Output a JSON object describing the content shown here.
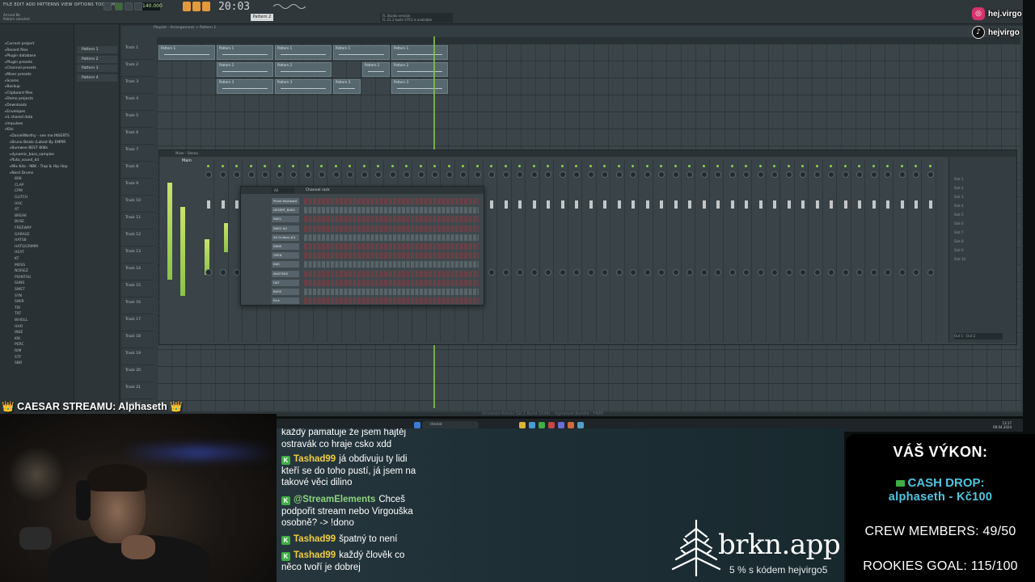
{
  "daw": {
    "menu": "FILE EDIT ADD PATTERNS VIEW OPTIONS TOOLS HELP",
    "song_info": [
      "Arrived 8b",
      "Pattern selected"
    ],
    "tempo": "140.000",
    "clock": "20:03",
    "clock_small": "0",
    "pattern_selector": "Pattern 2",
    "hint": [
      "FL Studio version",
      "FL 21.2 build 3753 is available"
    ],
    "browser_items": [
      "Current project",
      "Recent files",
      "Plugin database",
      "Plugin presets",
      "Channel presets",
      "Mixer presets",
      "Scores",
      "Backup",
      "Clipboard files",
      "Demo projects",
      "Downloads",
      "Envelopes",
      "IL shared data",
      "Impulses",
      "Kits"
    ],
    "kits_items": [
      "DanielWorthy - see me INSERTS",
      "Bruno Beats (Latest By EMPIR",
      "Bumwee BEST 808s",
      "dynamic_bass_samples",
      "fluto_sound_kit",
      "Mix Kits - 9BK - Trap & Hip Hop",
      "Nord Drums"
    ],
    "nord_items": [
      "808",
      "CLAP",
      "CPM",
      "GLITCH",
      "HHC",
      "AT",
      "BREAK",
      "BUSE",
      "FREEWAY",
      "GARAGE",
      "HATS8",
      "HATS/GRIMM",
      "HEAT",
      "KT",
      "MOSS",
      "NOISEZ",
      "POINTHU",
      "SUNS",
      "SWET",
      "SYN",
      "SWIR",
      "TIR",
      "TRT",
      "WHOLL",
      "HHO",
      "INSE",
      "KIK",
      "PERC",
      "RIM",
      "STF",
      "SNR"
    ],
    "patterns": [
      "Pattern 1",
      "Pattern 2",
      "Pattern 3",
      "Pattern 4"
    ],
    "playlist_title": "Playlist - Arrangement > Pattern 1",
    "tracks": [
      "Track 1",
      "Track 2",
      "Track 3",
      "Track 4",
      "Track 5",
      "Track 6",
      "Track 7",
      "Track 8",
      "Track 9",
      "Track 10",
      "Track 11",
      "Track 12",
      "Track 13",
      "Track 14",
      "Track 15",
      "Track 16",
      "Track 17",
      "Track 18",
      "Track 19",
      "Track 20",
      "Track 21",
      "Track 22"
    ],
    "clips": [
      {
        "label": "Pattern 1",
        "row": 0
      },
      {
        "label": "Pattern 2",
        "row": 1
      },
      {
        "label": "Pattern 3",
        "row": 2
      }
    ],
    "mixer_title": "Mixer - Stereo",
    "mixer_master": "Main",
    "mixer_slots": [
      "Slot 1",
      "Slot 2",
      "Slot 3",
      "Slot 4",
      "Slot 5",
      "Slot 6",
      "Slot 7",
      "Slot 8",
      "Slot 9",
      "Slot 10"
    ],
    "mixer_out": "Out 1 - Out 2",
    "rack_title": "Channel rack",
    "rack_filter": "All",
    "rack_channels": [
      "Plonk Keyboard",
      "DESERT_BASS",
      "SNR1",
      "SNR2 #2",
      "Air Guitars #4",
      "SNRE",
      "OPEN",
      "KNS",
      "MASTERS",
      "HAT",
      "BASS",
      "Kick"
    ],
    "version_text": "Vincenzo Kinisis (Gt 2 Build 1549) - Signature Bundle - FREE",
    "taskbar_search": "Hledat",
    "taskbar_clock": [
      "13:17",
      "09.04.2024"
    ]
  },
  "social": {
    "instagram": "hej.virgo",
    "tiktok": "hejvirgo"
  },
  "caesar": {
    "label": "CAESAR STREAMU: Alphaseth",
    "crown": "👑"
  },
  "chat": [
    {
      "user": "",
      "text": "každý pamatuje že jsem hajtěj ostravák co hraje csko xdd",
      "badge": false
    },
    {
      "user": "Tashad99",
      "text": "já obdivuju ty lidi kteří se do toho pustí, já jsem na takové věci dilino",
      "badge": true
    },
    {
      "user": "@StreamElements",
      "text": "Chceš podpořit stream nebo Virgouška osobně? -> !dono",
      "badge": true,
      "se": true
    },
    {
      "user": "Tashad99",
      "text": "špatný to není",
      "badge": true
    },
    {
      "user": "Tashad99",
      "text": "každý člověk co něco tvoří je dobrej",
      "badge": true
    }
  ],
  "sponsor": {
    "logo_text": "brkn.app",
    "subtitle": "5 % s kódem hejvirgo5"
  },
  "stats": {
    "title": "VÁŠ VÝKON:",
    "cash_drop_label": "CASH DROP:",
    "cash_drop_user": "alphaseth - Kč100",
    "crew": "CREW MEMBERS: 49/50",
    "rookies": "ROOKIES GOAL: 115/100"
  },
  "colors": {
    "accent_green": "#7fc24b",
    "cash_drop": "#4fc6e0",
    "chat_user": "#f0cf3f"
  }
}
